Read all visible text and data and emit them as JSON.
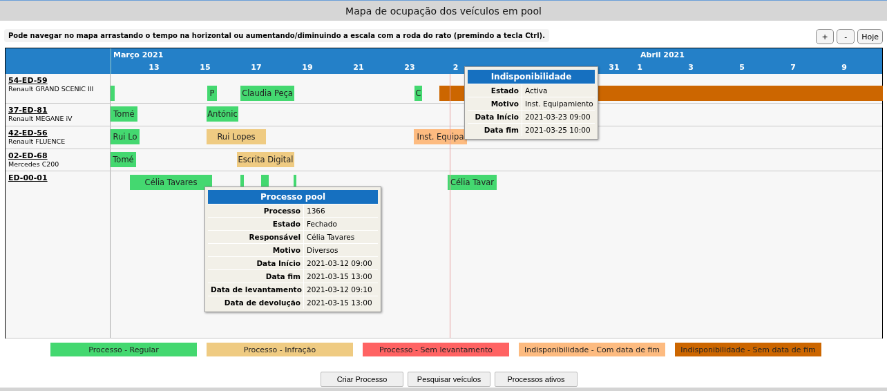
{
  "title": "Mapa de ocupação dos veículos em pool",
  "hint": "Pode navegar no mapa arrastando o tempo na horizontal ou aumentando/diminuindo a escala com a roda do rato (premindo a tecla Ctrl).",
  "zoom_buttons": [
    "+",
    "-",
    "Hoje"
  ],
  "timeline": {
    "months": [
      "Março 2021",
      "Abril 2021"
    ],
    "ticks": [
      "13",
      "15",
      "17",
      "19",
      "21",
      "23",
      "2",
      "31",
      "1",
      "3",
      "5",
      "7",
      "9"
    ]
  },
  "vehicles": [
    {
      "plate": "54-ED-59",
      "model": "Renault GRAND SCENIC III",
      "bars": [
        {
          "kind": "regular"
        },
        {
          "kind": "regular",
          "label": "P"
        },
        {
          "kind": "regular",
          "label": "Claudia Peça"
        },
        {
          "kind": "regular",
          "label": "C"
        },
        {
          "kind": "unavailable_open"
        }
      ]
    },
    {
      "plate": "37-ED-81",
      "model": "Renault MEGANE iV",
      "bars": [
        {
          "kind": "regular",
          "label": "Tomé"
        },
        {
          "kind": "regular",
          "label": "Antónic"
        }
      ]
    },
    {
      "plate": "42-ED-56",
      "model": "Renault FLUENCE",
      "bars": [
        {
          "kind": "regular",
          "label": "Rui Lo"
        },
        {
          "kind": "infraction",
          "label": "Rui Lopes"
        },
        {
          "kind": "unavailable_dated",
          "label": "Inst. Equipa"
        }
      ]
    },
    {
      "plate": "02-ED-68",
      "model": "Mercedes C200",
      "bars": [
        {
          "kind": "regular",
          "label": "Tomé"
        },
        {
          "kind": "infraction",
          "label": "Escrita Digital"
        }
      ]
    },
    {
      "plate": "ED-00-01",
      "bars": [
        {
          "kind": "regular",
          "label": "Célia Tavares"
        },
        {
          "kind": "regular"
        },
        {
          "kind": "regular"
        },
        {
          "kind": "regular"
        },
        {
          "kind": "regular",
          "label": "Célia Tavar"
        }
      ]
    }
  ],
  "tooltips": [
    {
      "title": "Indisponibilidade",
      "fields": [
        {
          "label": "Estado",
          "value": "Activa"
        },
        {
          "label": "Motivo",
          "value": "Inst. Equipamiento"
        },
        {
          "label": "Data Início",
          "value": "2021-03-23 09:00"
        },
        {
          "label": "Data fim",
          "value": "2021-03-25 10:00"
        }
      ]
    },
    {
      "title": "Processo pool",
      "fields": [
        {
          "label": "Processo",
          "value": "1366"
        },
        {
          "label": "Estado",
          "value": "Fechado"
        },
        {
          "label": "Responsável",
          "value": "Célia Tavares"
        },
        {
          "label": "Motivo",
          "value": "Diversos"
        },
        {
          "label": "Data Início",
          "value": "2021-03-12 09:00"
        },
        {
          "label": "Data fim",
          "value": "2021-03-15 13:00"
        },
        {
          "label": "Data de levantamento",
          "value": "2021-03-12 09:10"
        },
        {
          "label": "Data de devolução",
          "value": "2021-03-15 13:00"
        }
      ]
    }
  ],
  "legend": [
    {
      "label": "Processo - Regular",
      "color": "#44d870"
    },
    {
      "label": "Processo - Infração",
      "color": "#efcb82"
    },
    {
      "label": "Processo - Sem levantamento",
      "color": "#ff6363"
    },
    {
      "label": "Indisponibilidade - Com data de fim",
      "color": "#fdbb80"
    },
    {
      "label": "Indisponibilidade - Sem data de fim",
      "color": "#cc6600"
    }
  ],
  "actions": [
    "Criar Processo",
    "Pesquisar veículos",
    "Processos ativos"
  ]
}
